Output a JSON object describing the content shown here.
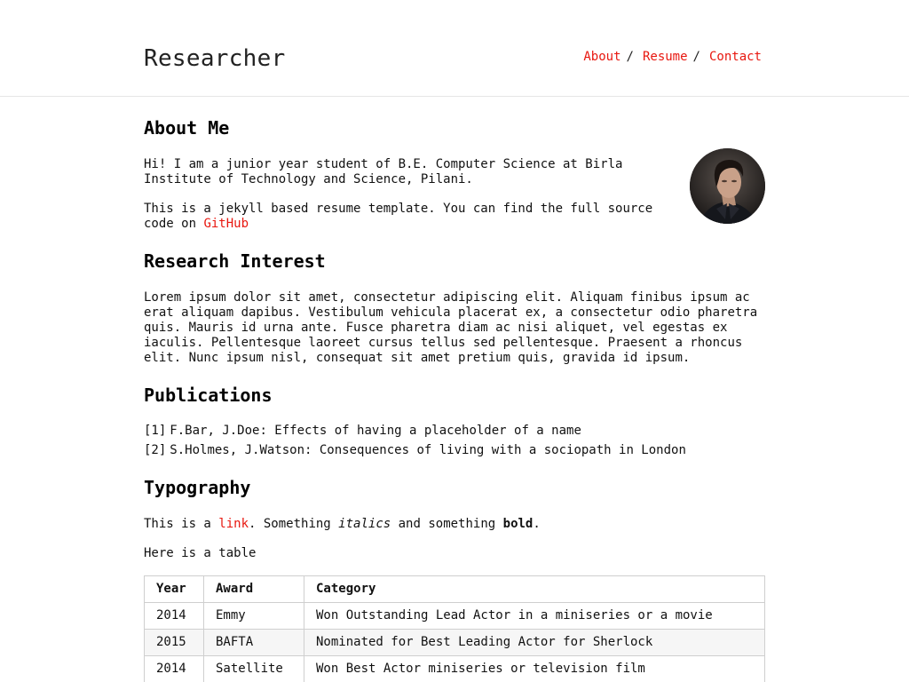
{
  "header": {
    "site_title": "Researcher",
    "nav": [
      {
        "label": "About",
        "sep": "/"
      },
      {
        "label": "Resume",
        "sep": "/"
      },
      {
        "label": "Contact",
        "sep": ""
      }
    ]
  },
  "about": {
    "heading": "About Me",
    "intro": "Hi! I am a junior year student of B.E. Computer Science at Birla Institute of Technology and Science, Pilani.",
    "template_text": "This is a jekyll based resume template. You can find the full source code on",
    "github_link": "GitHub",
    "avatar_alt": "profile-photo"
  },
  "research": {
    "heading": "Research Interest",
    "body": "Lorem ipsum dolor sit amet, consectetur adipiscing elit. Aliquam finibus ipsum ac erat aliquam dapibus. Vestibulum vehicula placerat ex, a consectetur odio pharetra quis. Mauris id urna ante. Fusce pharetra diam ac nisi aliquet, vel egestas ex iaculis. Pellentesque laoreet cursus tellus sed pellentesque. Praesent a rhoncus elit. Nunc ipsum nisl, consequat sit amet pretium quis, gravida id ipsum."
  },
  "publications": {
    "heading": "Publications",
    "items": [
      {
        "num": "[1]",
        "text": "F.Bar, J.Doe: Effects of having a placeholder of a name"
      },
      {
        "num": "[2]",
        "text": "S.Holmes, J.Watson: Consequences of living with a sociopath in London"
      }
    ]
  },
  "typography": {
    "heading": "Typography",
    "line_prefix": "This is a",
    "link_text": "link",
    "line_mid": ". Something",
    "italic_text": "italics",
    "line_and": "and something",
    "bold_text": "bold",
    "line_end": ".",
    "table_intro": "Here is a table",
    "table": {
      "headers": [
        "Year",
        "Award",
        "Category"
      ],
      "rows": [
        [
          "2014",
          "Emmy",
          "Won Outstanding Lead Actor in a miniseries or a movie"
        ],
        [
          "2015",
          "BAFTA",
          "Nominated for Best Leading Actor for Sherlock"
        ],
        [
          "2014",
          "Satellite",
          "Won Best Actor miniseries or television film"
        ]
      ]
    }
  },
  "colors": {
    "accent": "#e8170f"
  }
}
